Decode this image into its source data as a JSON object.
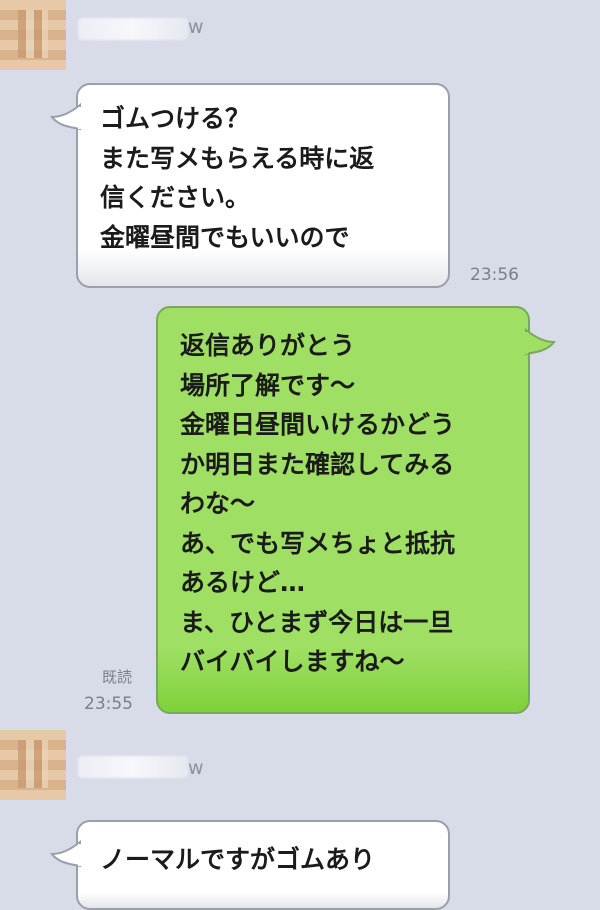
{
  "messages": {
    "first": {
      "sender_suffix": "w",
      "lines": [
        "ゴムつける？",
        "また写メもらえる時に返",
        "信ください。",
        "金曜昼間でもいいので"
      ],
      "time": "23:56"
    },
    "reply": {
      "lines": [
        "返信ありがとう",
        "場所了解です〜",
        "金曜日昼間いけるかどう",
        "か明日また確認してみる",
        "わな〜",
        "あ、でも写メちょと抵抗",
        "あるけど…",
        "ま、ひとまず今日は一旦",
        "バイバイしますね〜"
      ],
      "read_status": "既読",
      "time": "23:55"
    },
    "second": {
      "sender_suffix": "w",
      "lines": [
        "ノーマルですがゴムあり"
      ]
    }
  },
  "colors": {
    "background": "#d8dbe8",
    "incoming_bubble": "#ffffff",
    "outgoing_bubble": "#9fe064"
  },
  "icons": {
    "avatar": "blurred-profile-avatar"
  }
}
